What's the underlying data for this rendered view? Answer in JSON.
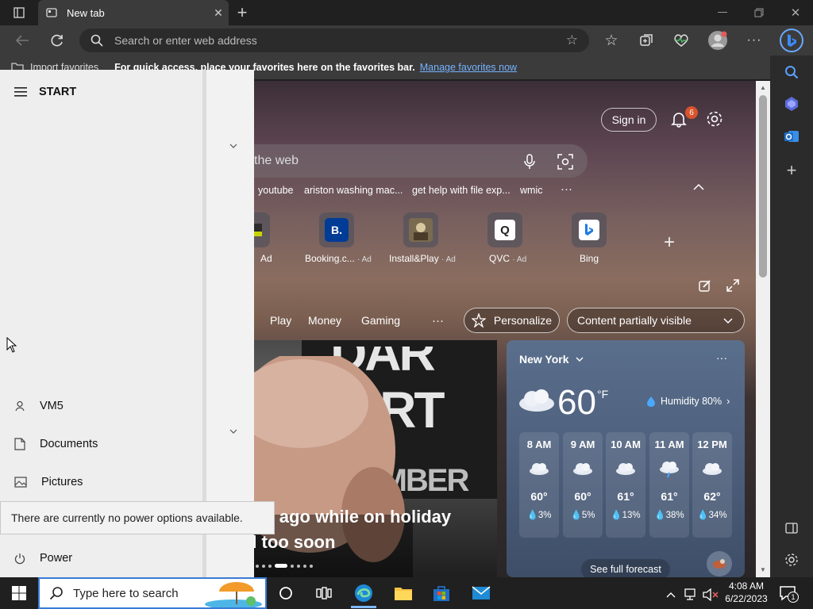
{
  "browser": {
    "tab_title": "New tab",
    "address_placeholder": "Search or enter web address",
    "favorites": {
      "import_label": "Import favorites",
      "message": "For quick access, place your favorites here on the favorites bar.",
      "manage_link": "Manage favorites now"
    }
  },
  "newtab": {
    "sign_in": "Sign in",
    "notification_count": "6",
    "search_text": "the web",
    "suggestions": [
      "youtube",
      "ariston washing mac...",
      "get help with file exp...",
      "wmic"
    ],
    "tiles": [
      {
        "label": "",
        "ad": "Ad"
      },
      {
        "label": "Booking.c...",
        "ad": "· Ad",
        "glyph": "B."
      },
      {
        "label": "Install&Play",
        "ad": "· Ad"
      },
      {
        "label": "QVC",
        "ad": "· Ad",
        "glyph": "Q"
      },
      {
        "label": "Bing",
        "ad": ""
      }
    ],
    "nav": [
      "Play",
      "Money",
      "Gaming"
    ],
    "more": "···",
    "personalize": "Personalize",
    "content_visibility": "Content partially visible",
    "hero": {
      "line1": "de ago while on holiday",
      "line2": "d too soon"
    },
    "weather": {
      "city": "New York",
      "temperature": "60",
      "unit": "°F",
      "humidity": "Humidity 80%",
      "hours": [
        {
          "time": "8 AM",
          "temp": "60°",
          "precip": "3%"
        },
        {
          "time": "9 AM",
          "temp": "60°",
          "precip": "5%"
        },
        {
          "time": "10 AM",
          "temp": "61°",
          "precip": "13%"
        },
        {
          "time": "11 AM",
          "temp": "61°",
          "precip": "38%"
        },
        {
          "time": "12 PM",
          "temp": "62°",
          "precip": "34%"
        }
      ],
      "full_forecast": "See full forecast"
    }
  },
  "start_menu": {
    "title": "START",
    "items": [
      {
        "label": "VM5"
      },
      {
        "label": "Documents"
      },
      {
        "label": "Pictures"
      },
      {
        "label": "Power"
      }
    ],
    "tooltip": "There are currently no power options available."
  },
  "taskbar": {
    "search_placeholder": "Type here to search",
    "time": "4:08 AM",
    "date": "6/22/2023",
    "notification_count": "1"
  }
}
